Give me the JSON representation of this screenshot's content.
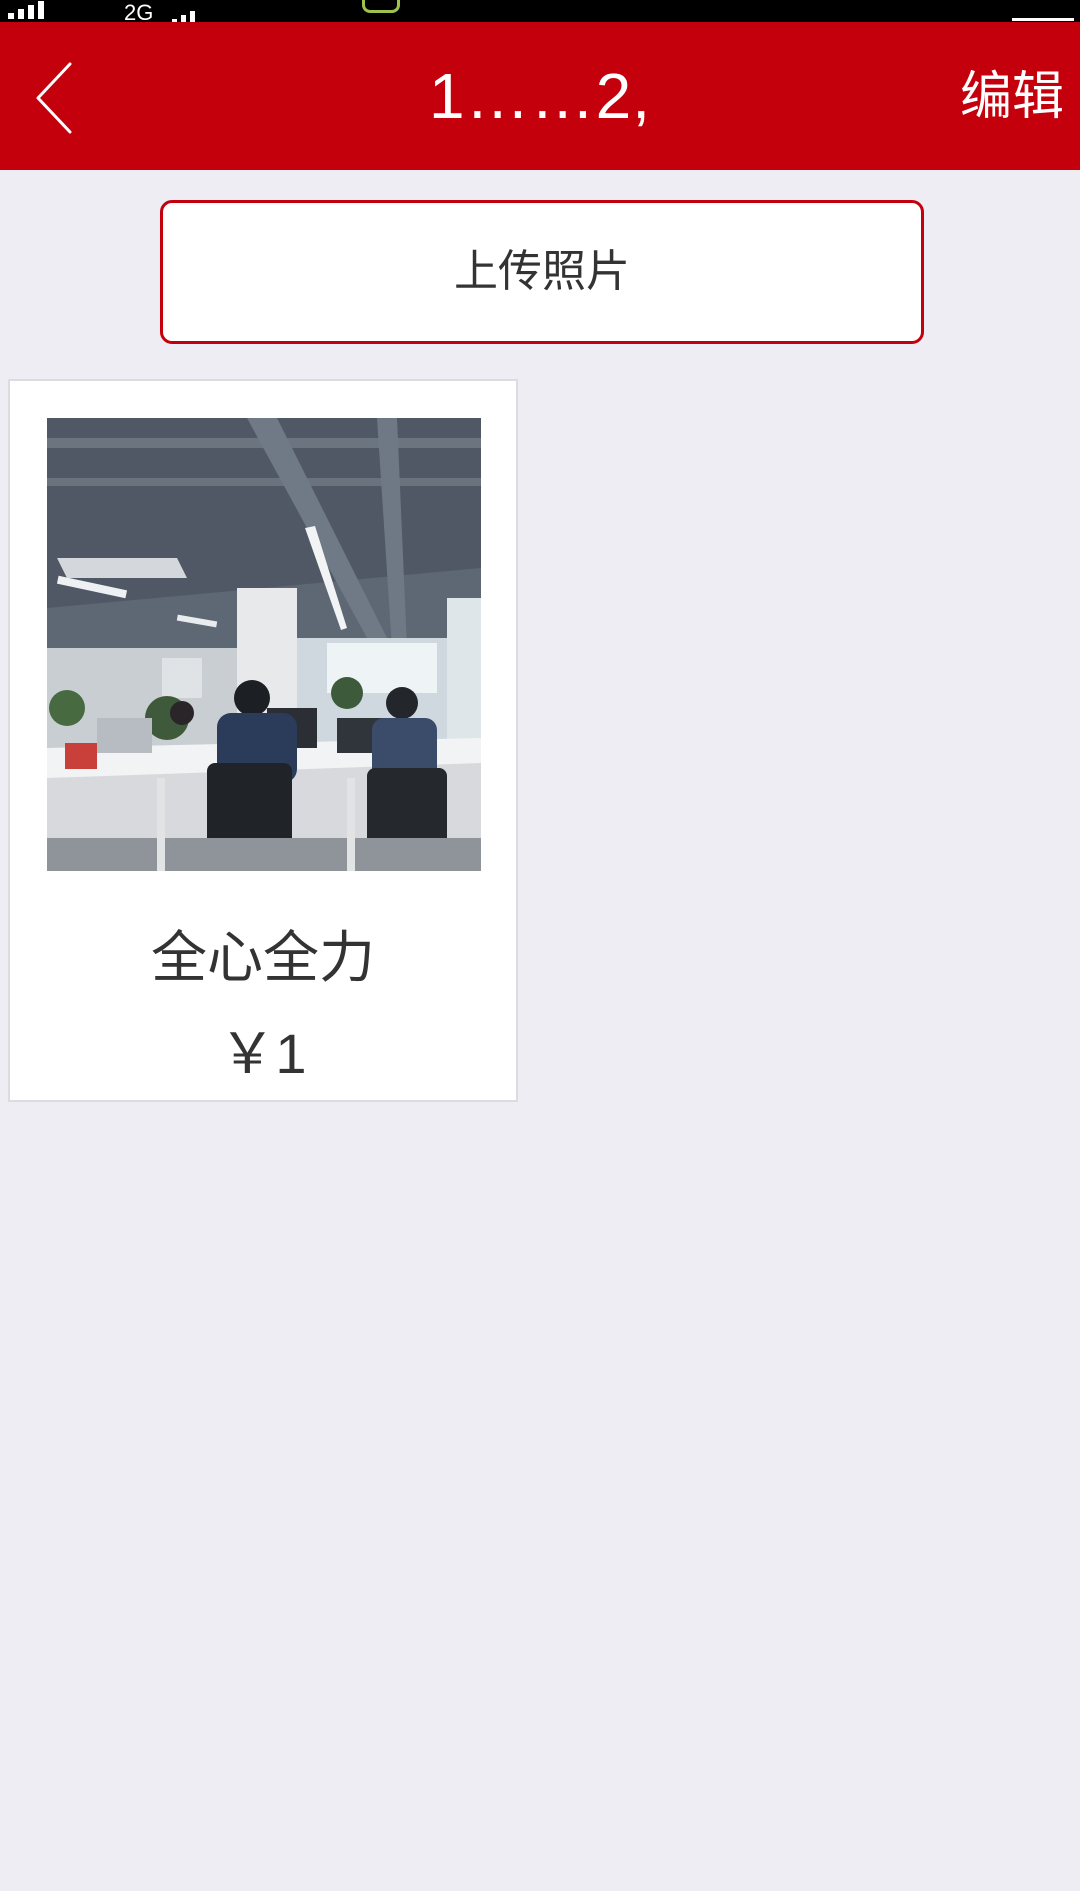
{
  "status_bar": {
    "network_label": "2G"
  },
  "header": {
    "title": "1……2,",
    "edit_label": "编辑",
    "back_icon": "chevron-left-icon"
  },
  "upload": {
    "label": "上传照片"
  },
  "photos": [
    {
      "name": "全心全力",
      "price": "￥1"
    }
  ],
  "colors": {
    "header_bg": "#c3000c",
    "page_bg": "#eeedf3",
    "accent_border": "#c3000c",
    "text_dark": "#333333"
  }
}
